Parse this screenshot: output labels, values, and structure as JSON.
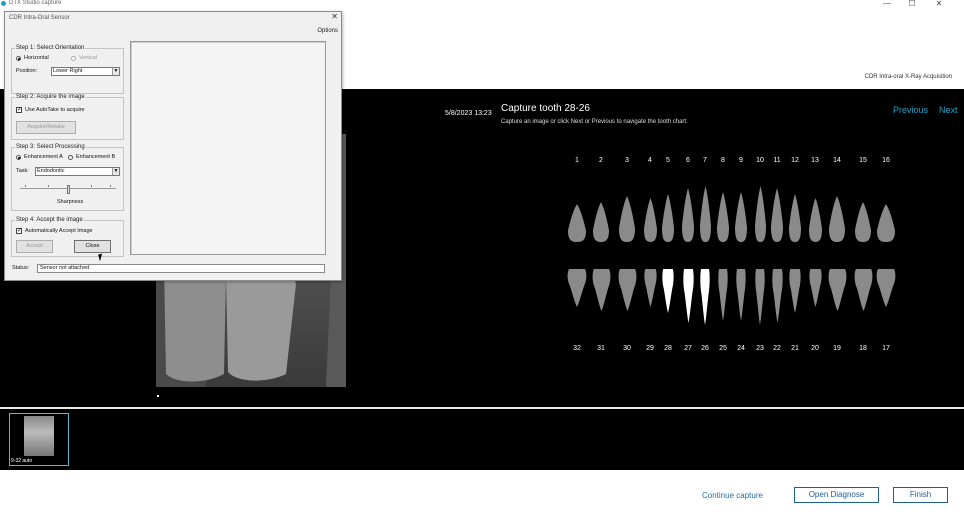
{
  "window": {
    "title": "DTX Studio capture",
    "controls": {
      "minimize": "—",
      "maximize": "☐",
      "close": "✕"
    }
  },
  "header": {
    "acquisition_label": "CDR Intra-oral X-Ray Acquisition"
  },
  "capture": {
    "date": "5/8/2023 13:23",
    "title": "Capture tooth 28-26",
    "subtitle": "Capture an image or click Next or Previous to navigate the tooth chart.",
    "previous_label": "Previous",
    "next_label": "Next"
  },
  "tooth_chart": {
    "upper_numbers": [
      "1",
      "2",
      "3",
      "4",
      "5",
      "6",
      "7",
      "8",
      "9",
      "10",
      "11",
      "12",
      "13",
      "14",
      "15",
      "16"
    ],
    "lower_numbers": [
      "32",
      "31",
      "30",
      "29",
      "28",
      "27",
      "26",
      "25",
      "24",
      "23",
      "22",
      "21",
      "20",
      "19",
      "18",
      "17"
    ],
    "selected_lower": [
      "28",
      "27",
      "26"
    ],
    "tooth_color": "#8a8a8a",
    "selected_color": "#ffffff"
  },
  "filmstrip": {
    "thumbnail_label": "9-32 auto"
  },
  "footer": {
    "continue_label": "Continue capture",
    "open_diagnose_label": "Open Diagnose",
    "finish_label": "Finish"
  },
  "dialog": {
    "title": "CDR Intra-Oral Sensor",
    "close": "✕",
    "options_label": "Options",
    "step1": {
      "title": "Step 1: Select Orientation",
      "horizontal_label": "Horizontal",
      "vertical_label": "Vertical",
      "position_label": "Position:",
      "position_value": "Lower Right"
    },
    "step2": {
      "title": "Step 2: Acquire the image",
      "autotake_label": "Use AutoTake to acquire",
      "acquire_button": "Acquire/Retake"
    },
    "step3": {
      "title": "Step 3: Select Processing",
      "enhancement_a": "Enhancement A",
      "enhancement_b": "Enhancement B",
      "task_label": "Task:",
      "task_value": "Endodontic",
      "sharpness_label": "Sharpness",
      "sharpness_level": 0.5
    },
    "step4": {
      "title": "Step 4: Accept the image",
      "auto_accept_label": "Automatically Accept Image",
      "accept_button": "Accept",
      "close_button": "Close"
    },
    "status_label": "Status:",
    "status_value": "Sensor not attached"
  }
}
